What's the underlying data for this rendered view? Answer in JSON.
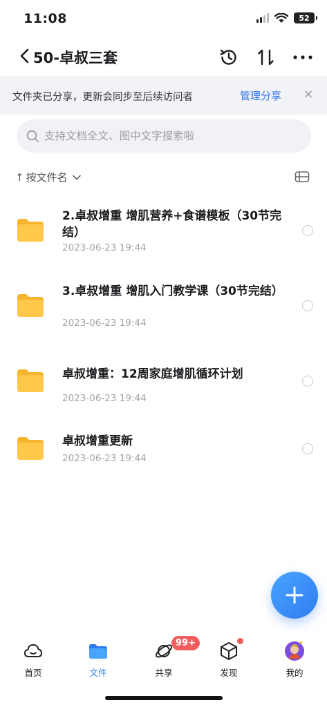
{
  "status_bar": {
    "time": "11:08",
    "battery": "52"
  },
  "nav": {
    "title": "50-卓叔三套"
  },
  "banner": {
    "text": "文件夹已分享，更新会同步至后续访问者",
    "link": "管理分享",
    "close": "×"
  },
  "search": {
    "placeholder": "支持文档全文、图中文字搜索啦"
  },
  "sort": {
    "label": "按文件名",
    "arrow": "↑"
  },
  "files": [
    {
      "name": "2.卓叔增重 增肌营养+食谱模板（30节完结）",
      "date": "2023-06-23 19:44"
    },
    {
      "name": "3.卓叔增重  增肌入门教学课（30节完结）",
      "date": "2023-06-23 19:44"
    },
    {
      "name": "卓叔增重：12周家庭增肌循环计划",
      "date": "2023-06-23 19:44"
    },
    {
      "name": "卓叔增重更新",
      "date": "2023-06-23 19:44"
    }
  ],
  "tabs": [
    {
      "label": "首页",
      "icon": "cloud-icon"
    },
    {
      "label": "文件",
      "icon": "folder-icon"
    },
    {
      "label": "共享",
      "icon": "share-orbit-icon",
      "badge": "99+"
    },
    {
      "label": "发现",
      "icon": "cube-icon"
    },
    {
      "label": "我的",
      "icon": "avatar-icon"
    }
  ],
  "colors": {
    "accent": "#2f7cf0",
    "folder": "#ffc84a",
    "badge": "#f05d5d"
  }
}
